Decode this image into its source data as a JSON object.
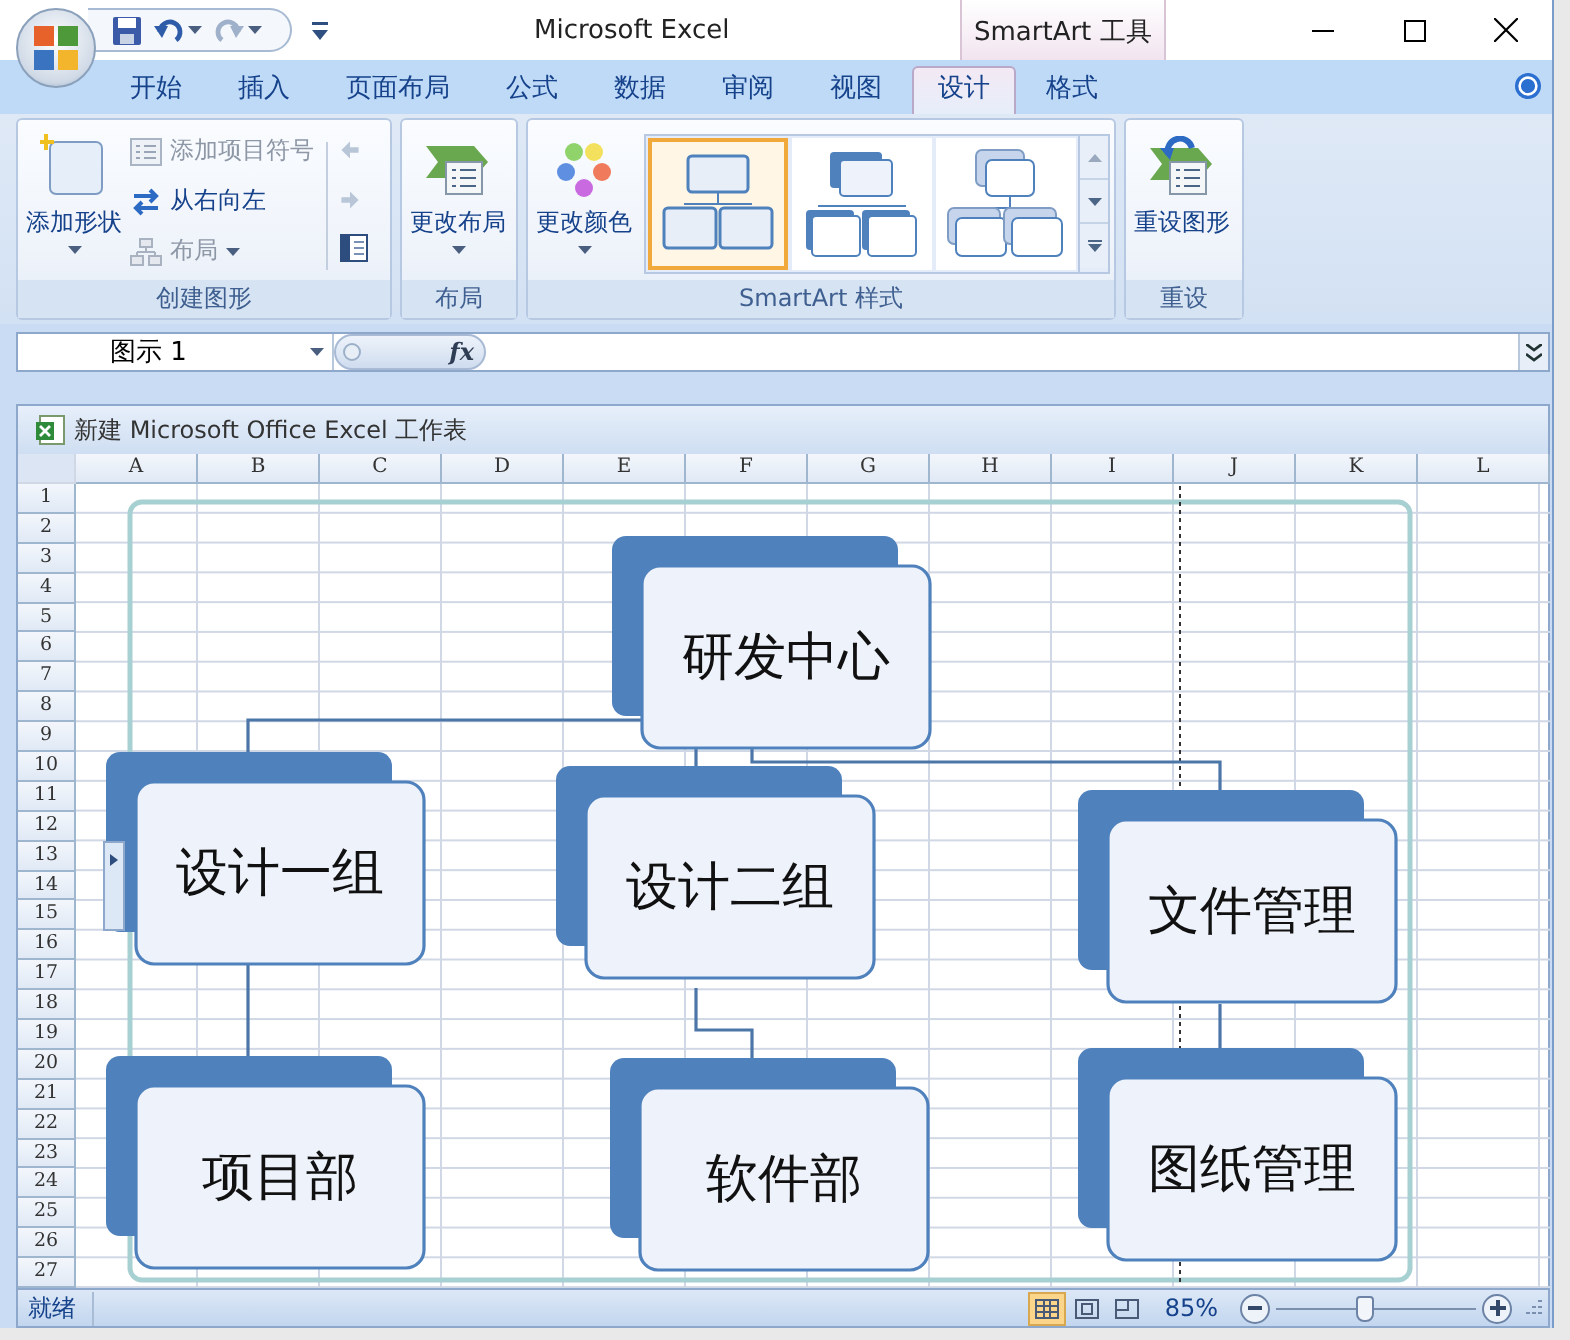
{
  "window": {
    "title": "Microsoft Excel",
    "context_tab": "SmartArt 工具"
  },
  "tabs": [
    {
      "label": "开始",
      "selected": false
    },
    {
      "label": "插入",
      "selected": false
    },
    {
      "label": "页面布局",
      "selected": false
    },
    {
      "label": "公式",
      "selected": false
    },
    {
      "label": "数据",
      "selected": false
    },
    {
      "label": "审阅",
      "selected": false
    },
    {
      "label": "视图",
      "selected": false
    },
    {
      "label": "设计",
      "selected": true
    },
    {
      "label": "格式",
      "selected": false
    }
  ],
  "ribbon": {
    "groups": [
      {
        "label": "创建图形",
        "buttons": [
          {
            "label": "添加形状",
            "disabled": false
          },
          {
            "label": "添加项目符号",
            "disabled": true
          },
          {
            "label": "从右向左",
            "disabled": false
          },
          {
            "label": "布局",
            "disabled": true
          }
        ]
      },
      {
        "label": "布局",
        "buttons": [
          {
            "label": "更改布局",
            "disabled": false
          }
        ]
      },
      {
        "label": "SmartArt 样式",
        "buttons": [
          {
            "label": "更改颜色",
            "disabled": false
          }
        ],
        "gallery": [
          {
            "selected": true
          },
          {
            "selected": false
          },
          {
            "selected": false
          }
        ]
      },
      {
        "label": "重设",
        "buttons": [
          {
            "label": "重设图形",
            "disabled": false
          }
        ]
      }
    ]
  },
  "formula_bar": {
    "name_box": "图示 1",
    "function_label": "fx"
  },
  "workbook": {
    "title": "新建 Microsoft Office Excel 工作表",
    "columns": [
      "A",
      "B",
      "C",
      "D",
      "E",
      "F",
      "G",
      "H",
      "I",
      "J",
      "K",
      "L"
    ],
    "rows": [
      "1",
      "2",
      "3",
      "4",
      "5",
      "6",
      "7",
      "8",
      "9",
      "10",
      "11",
      "12",
      "13",
      "14",
      "15",
      "16",
      "17",
      "18",
      "19",
      "20",
      "21",
      "22",
      "23",
      "24",
      "25",
      "26",
      "27"
    ]
  },
  "smartart": {
    "nodes": [
      {
        "text": "研发中心",
        "children": [
          {
            "text": "设计一组",
            "children": [
              {
                "text": "项目部"
              }
            ]
          },
          {
            "text": "设计二组",
            "children": [
              {
                "text": "软件部"
              }
            ]
          },
          {
            "text": "文件管理",
            "children": [
              {
                "text": "图纸管理"
              }
            ]
          }
        ]
      }
    ]
  },
  "status_bar": {
    "status": "就绪",
    "views": [
      {
        "selected": true
      },
      {
        "selected": false
      },
      {
        "selected": false
      }
    ],
    "zoom": "85%",
    "zoom_slider": {
      "level": 0.44
    }
  }
}
